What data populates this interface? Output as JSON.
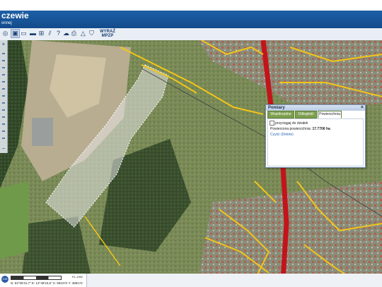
{
  "header": {
    "title": "czewie",
    "subtitle": "onnej"
  },
  "toolbar": {
    "wyraz_line1": "WYRAŹ",
    "wyraz_line2": "MPZP"
  },
  "dialog": {
    "title": "Pomiary",
    "close": "×",
    "tabs": [
      "Współrzędne",
      "Odległość",
      "Powierzchnia"
    ],
    "active_tab": "Powierzchnia",
    "checkbox_label": "przyciągaj do działek",
    "area_label": "Powierzona powierzchnia:",
    "area_value": "17.7706 ha",
    "clear_label": "Czyść",
    "delete_label": "(Delete)"
  },
  "statusbar": {
    "logo": "GIS",
    "scale_label": "200M",
    "scale_right": "PL-1992",
    "coords": "N: 54°05'31,7\"  E: 13°48'23,6\"  X: 591072  Y: 489172"
  },
  "colors": {
    "header": "#1d5fa6",
    "road_main": "#c4141b",
    "road_minor": "#f2c518",
    "tab_inactive": "#7ea04e"
  }
}
